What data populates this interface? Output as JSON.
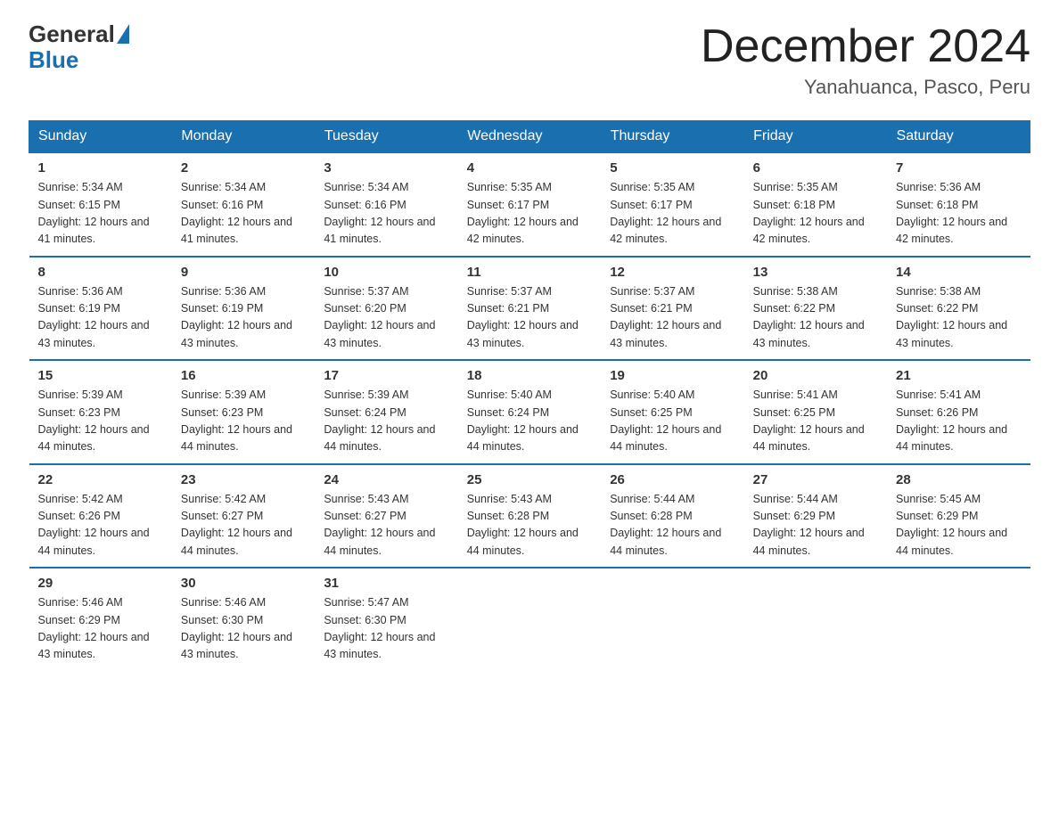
{
  "logo": {
    "general": "General",
    "blue": "Blue"
  },
  "title": "December 2024",
  "subtitle": "Yanahuanca, Pasco, Peru",
  "days_of_week": [
    "Sunday",
    "Monday",
    "Tuesday",
    "Wednesday",
    "Thursday",
    "Friday",
    "Saturday"
  ],
  "weeks": [
    [
      {
        "day": "1",
        "sunrise": "5:34 AM",
        "sunset": "6:15 PM",
        "daylight": "12 hours and 41 minutes."
      },
      {
        "day": "2",
        "sunrise": "5:34 AM",
        "sunset": "6:16 PM",
        "daylight": "12 hours and 41 minutes."
      },
      {
        "day": "3",
        "sunrise": "5:34 AM",
        "sunset": "6:16 PM",
        "daylight": "12 hours and 41 minutes."
      },
      {
        "day": "4",
        "sunrise": "5:35 AM",
        "sunset": "6:17 PM",
        "daylight": "12 hours and 42 minutes."
      },
      {
        "day": "5",
        "sunrise": "5:35 AM",
        "sunset": "6:17 PM",
        "daylight": "12 hours and 42 minutes."
      },
      {
        "day": "6",
        "sunrise": "5:35 AM",
        "sunset": "6:18 PM",
        "daylight": "12 hours and 42 minutes."
      },
      {
        "day": "7",
        "sunrise": "5:36 AM",
        "sunset": "6:18 PM",
        "daylight": "12 hours and 42 minutes."
      }
    ],
    [
      {
        "day": "8",
        "sunrise": "5:36 AM",
        "sunset": "6:19 PM",
        "daylight": "12 hours and 43 minutes."
      },
      {
        "day": "9",
        "sunrise": "5:36 AM",
        "sunset": "6:19 PM",
        "daylight": "12 hours and 43 minutes."
      },
      {
        "day": "10",
        "sunrise": "5:37 AM",
        "sunset": "6:20 PM",
        "daylight": "12 hours and 43 minutes."
      },
      {
        "day": "11",
        "sunrise": "5:37 AM",
        "sunset": "6:21 PM",
        "daylight": "12 hours and 43 minutes."
      },
      {
        "day": "12",
        "sunrise": "5:37 AM",
        "sunset": "6:21 PM",
        "daylight": "12 hours and 43 minutes."
      },
      {
        "day": "13",
        "sunrise": "5:38 AM",
        "sunset": "6:22 PM",
        "daylight": "12 hours and 43 minutes."
      },
      {
        "day": "14",
        "sunrise": "5:38 AM",
        "sunset": "6:22 PM",
        "daylight": "12 hours and 43 minutes."
      }
    ],
    [
      {
        "day": "15",
        "sunrise": "5:39 AM",
        "sunset": "6:23 PM",
        "daylight": "12 hours and 44 minutes."
      },
      {
        "day": "16",
        "sunrise": "5:39 AM",
        "sunset": "6:23 PM",
        "daylight": "12 hours and 44 minutes."
      },
      {
        "day": "17",
        "sunrise": "5:39 AM",
        "sunset": "6:24 PM",
        "daylight": "12 hours and 44 minutes."
      },
      {
        "day": "18",
        "sunrise": "5:40 AM",
        "sunset": "6:24 PM",
        "daylight": "12 hours and 44 minutes."
      },
      {
        "day": "19",
        "sunrise": "5:40 AM",
        "sunset": "6:25 PM",
        "daylight": "12 hours and 44 minutes."
      },
      {
        "day": "20",
        "sunrise": "5:41 AM",
        "sunset": "6:25 PM",
        "daylight": "12 hours and 44 minutes."
      },
      {
        "day": "21",
        "sunrise": "5:41 AM",
        "sunset": "6:26 PM",
        "daylight": "12 hours and 44 minutes."
      }
    ],
    [
      {
        "day": "22",
        "sunrise": "5:42 AM",
        "sunset": "6:26 PM",
        "daylight": "12 hours and 44 minutes."
      },
      {
        "day": "23",
        "sunrise": "5:42 AM",
        "sunset": "6:27 PM",
        "daylight": "12 hours and 44 minutes."
      },
      {
        "day": "24",
        "sunrise": "5:43 AM",
        "sunset": "6:27 PM",
        "daylight": "12 hours and 44 minutes."
      },
      {
        "day": "25",
        "sunrise": "5:43 AM",
        "sunset": "6:28 PM",
        "daylight": "12 hours and 44 minutes."
      },
      {
        "day": "26",
        "sunrise": "5:44 AM",
        "sunset": "6:28 PM",
        "daylight": "12 hours and 44 minutes."
      },
      {
        "day": "27",
        "sunrise": "5:44 AM",
        "sunset": "6:29 PM",
        "daylight": "12 hours and 44 minutes."
      },
      {
        "day": "28",
        "sunrise": "5:45 AM",
        "sunset": "6:29 PM",
        "daylight": "12 hours and 44 minutes."
      }
    ],
    [
      {
        "day": "29",
        "sunrise": "5:46 AM",
        "sunset": "6:29 PM",
        "daylight": "12 hours and 43 minutes."
      },
      {
        "day": "30",
        "sunrise": "5:46 AM",
        "sunset": "6:30 PM",
        "daylight": "12 hours and 43 minutes."
      },
      {
        "day": "31",
        "sunrise": "5:47 AM",
        "sunset": "6:30 PM",
        "daylight": "12 hours and 43 minutes."
      },
      null,
      null,
      null,
      null
    ]
  ]
}
